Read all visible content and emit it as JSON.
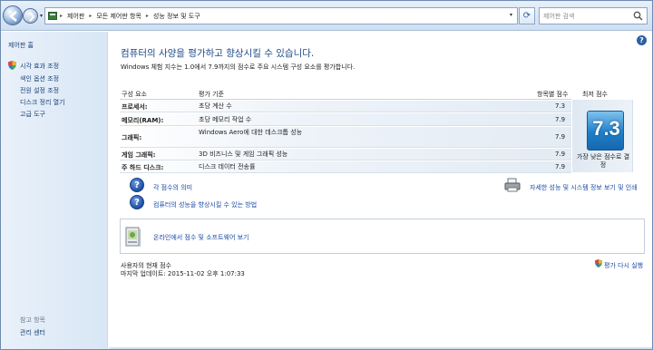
{
  "breadcrumb": [
    "제어판",
    "모든 제어판 항목",
    "성능 정보 및 도구"
  ],
  "search": {
    "placeholder": "제어판 검색"
  },
  "sidebar": {
    "home": "제어판 홈",
    "links": [
      "시각 효과 조정",
      "색인 옵션 조정",
      "전원 설정 조정",
      "디스크 정리 열기",
      "고급 도구"
    ],
    "see_also": "참고 항목",
    "see_also_links": [
      "관리 센터"
    ]
  },
  "main": {
    "heading": "컴퓨터의 사양을 평가하고 향상시킬 수 있습니다.",
    "intro": "Windows 체험 지수는 1.0에서 7.9까지의 점수로 주요 시스템 구성 요소를 평가합니다.",
    "table": {
      "headers": {
        "component": "구성 요소",
        "rating": "평가 기준",
        "subscore": "항목별 점수",
        "base": "최저 점수"
      },
      "rows": [
        {
          "component": "프로세서:",
          "rating": "초당 계산 수",
          "score": "7.3"
        },
        {
          "component": "메모리(RAM):",
          "rating": "초당 메모리 작업 수",
          "score": "7.9"
        },
        {
          "component": "그래픽:",
          "rating": "Windows Aero에 대한 데스크톱 성능",
          "score": "7.9"
        },
        {
          "component": "게임 그래픽:",
          "rating": "3D 비즈니스 및 게임 그래픽 성능",
          "score": "7.9"
        },
        {
          "component": "주 하드 디스크:",
          "rating": "디스크 데이터 전송률",
          "score": "7.9"
        }
      ],
      "base_score": "7.3",
      "base_note": "가장 낮은 점수로 결정"
    },
    "links": {
      "meaning": "각 점수의 의미",
      "improve": "컴퓨터의 성능을 향상시킬 수 있는 방법",
      "print": "자세한 성능 및 시스템 정보 보기 및 인쇄",
      "online": "온라인에서 점수 및 소프트웨어 보기",
      "rerun": "평가 다시 실행"
    },
    "status": {
      "label": "사용자의 현재 점수",
      "updated": "마지막 업데이트: 2015-11-02 오후 1:07:33"
    }
  },
  "colors": {
    "accent": "#1e4a8a",
    "link": "#1a4aa5",
    "badge": "#1f7fc9"
  }
}
